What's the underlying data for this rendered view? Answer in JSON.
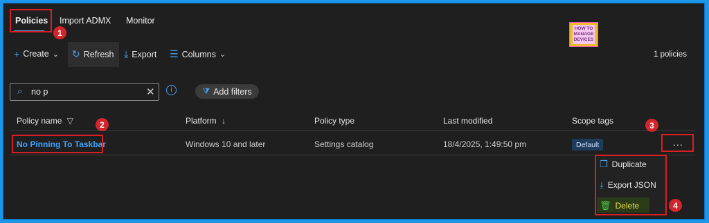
{
  "tabs": [
    "Policies",
    "Import ADMX",
    "Monitor"
  ],
  "toolbar": {
    "create": "Create",
    "refresh": "Refresh",
    "export": "Export",
    "columns": "Columns",
    "count": "1 policies"
  },
  "logo": {
    "line1": "HOW TO",
    "line2": "MANAGE",
    "line3": "DEVICES"
  },
  "search": {
    "value": "no p"
  },
  "filters_label": "Add filters",
  "table": {
    "headers": [
      "Policy name",
      "Platform",
      "Policy type",
      "Last modified",
      "Scope tags"
    ],
    "row": {
      "name": "No Pinning To Taskbar",
      "platform": "Windows 10 and later",
      "type": "Settings catalog",
      "modified": "18/4/2025, 1:49:50 pm",
      "scope": "Default"
    }
  },
  "row_actions": "...",
  "context_menu": [
    "Duplicate",
    "Export JSON",
    "Delete"
  ],
  "callouts": [
    "1",
    "2",
    "3",
    "4"
  ],
  "colors": {
    "accent": "#4aa0ec",
    "highlight": "#d81f26",
    "link": "#3da3ff"
  }
}
